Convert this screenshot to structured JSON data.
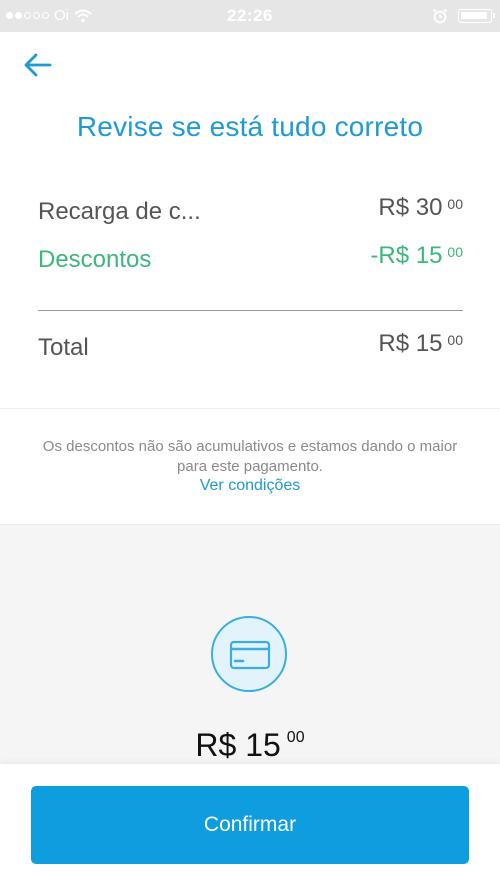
{
  "status_bar": {
    "carrier": "Oi",
    "time": "22:26",
    "signal_bars": 2,
    "signal_total": 5
  },
  "header": {
    "back_icon": "arrow-left-icon",
    "title": "Revise se está tudo correto"
  },
  "summary": {
    "items": [
      {
        "label": "Recarga de c...",
        "currency": "R$",
        "amount": "30",
        "cents": "00"
      },
      {
        "label": "Descontos",
        "currency": "-R$",
        "amount": "15",
        "cents": "00"
      }
    ],
    "total": {
      "label": "Total",
      "currency": "R$",
      "amount": "15",
      "cents": "00"
    }
  },
  "notice": {
    "text": "Os descontos não são acumulativos e estamos dando o maior para este pagamento.",
    "link": "Ver condições"
  },
  "payment": {
    "icon": "credit-card-icon",
    "currency": "R$",
    "amount": "15",
    "cents": "00"
  },
  "actions": {
    "confirm_label": "Confirmar"
  },
  "colors": {
    "accent": "#1e9ad6",
    "discount": "#3ab87a",
    "button": "#0e9ee0"
  }
}
